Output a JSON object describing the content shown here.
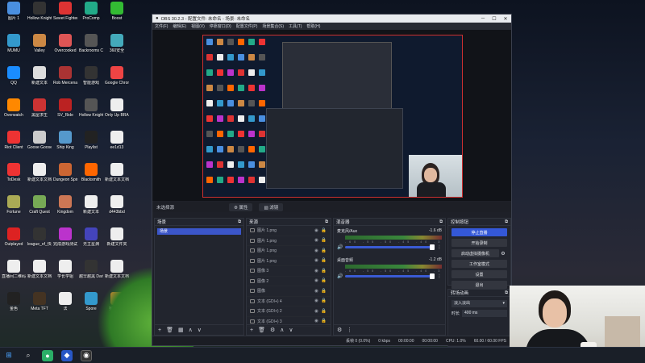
{
  "desktop_icons": [
    {
      "label": "图片 1",
      "color": "#4a8fe0",
      "col": 0,
      "row": 0
    },
    {
      "label": "Hollow Knight",
      "color": "#333",
      "col": 1,
      "row": 0
    },
    {
      "label": "Sweet Fighter",
      "color": "#d33",
      "col": 2,
      "row": 0
    },
    {
      "label": "ProComp",
      "color": "#2a8",
      "col": 3,
      "row": 0
    },
    {
      "label": "Boost",
      "color": "#3b3",
      "col": 4,
      "row": 0
    },
    {
      "label": "MUMU",
      "color": "#39c",
      "col": 0,
      "row": 1
    },
    {
      "label": "Valley",
      "color": "#c84",
      "col": 1,
      "row": 1
    },
    {
      "label": "Overcooked",
      "color": "#d55",
      "col": 2,
      "row": 1
    },
    {
      "label": "Backrooms Company",
      "color": "#555",
      "col": 3,
      "row": 1
    },
    {
      "label": "360安全",
      "color": "#4ab",
      "col": 4,
      "row": 1
    },
    {
      "label": "QQ",
      "color": "#1a8cff",
      "col": 0,
      "row": 2
    },
    {
      "label": "新建文本",
      "color": "#ddd",
      "col": 1,
      "row": 2
    },
    {
      "label": "Rob Mercenaries",
      "color": "#a33",
      "col": 2,
      "row": 2
    },
    {
      "label": "智能游戏",
      "color": "#333",
      "col": 3,
      "row": 2
    },
    {
      "label": "Google Chrome",
      "color": "#e44",
      "col": 4,
      "row": 2
    },
    {
      "label": "Overwatch",
      "color": "#f80",
      "col": 0,
      "row": 3
    },
    {
      "label": "黑屋求生",
      "color": "#c33",
      "col": 1,
      "row": 3
    },
    {
      "label": "SV_Ride",
      "color": "#b22",
      "col": 2,
      "row": 3
    },
    {
      "label": "Hollow Knight",
      "color": "#555",
      "col": 3,
      "row": 3
    },
    {
      "label": "Only Up BRAINROT",
      "color": "#eee",
      "col": 4,
      "row": 3
    },
    {
      "label": "Riot Client",
      "color": "#e33",
      "col": 0,
      "row": 4
    },
    {
      "label": "Goose Goose Duck",
      "color": "#ccc",
      "col": 1,
      "row": 4
    },
    {
      "label": "Ship King",
      "color": "#59c",
      "col": 2,
      "row": 4
    },
    {
      "label": "Playlist",
      "color": "#222",
      "col": 3,
      "row": 4
    },
    {
      "label": "ee1d13",
      "color": "#eee",
      "col": 4,
      "row": 4
    },
    {
      "label": "ToDesk",
      "color": "#e33",
      "col": 0,
      "row": 5
    },
    {
      "label": "新建文本文档",
      "color": "#eee",
      "col": 1,
      "row": 5
    },
    {
      "label": "Dungeon Spirits",
      "color": "#c63",
      "col": 2,
      "row": 5
    },
    {
      "label": "Blacksmith",
      "color": "#f60",
      "col": 3,
      "row": 5
    },
    {
      "label": "新建文本文档",
      "color": "#eee",
      "col": 4,
      "row": 5
    },
    {
      "label": "Fortune",
      "color": "#aa5",
      "col": 0,
      "row": 6
    },
    {
      "label": "Craft Quest",
      "color": "#7a5",
      "col": 1,
      "row": 6
    },
    {
      "label": "Kingdom",
      "color": "#c75",
      "col": 2,
      "row": 6
    },
    {
      "label": "新建文本",
      "color": "#eee",
      "col": 3,
      "row": 6
    },
    {
      "label": "d443bbd",
      "color": "#eee",
      "col": 4,
      "row": 6
    },
    {
      "label": "Outplayed",
      "color": "#d22",
      "col": 0,
      "row": 7
    },
    {
      "label": "league_of_快捷方式",
      "color": "#333",
      "col": 1,
      "row": 7
    },
    {
      "label": "完成游戏测试",
      "color": "#b3c",
      "col": 2,
      "row": 7
    },
    {
      "label": "无主星渊",
      "color": "#44b",
      "col": 3,
      "row": 7
    },
    {
      "label": "新建文件夹",
      "color": "#eee",
      "col": 4,
      "row": 7
    },
    {
      "label": "直播间二维码",
      "color": "#eee",
      "col": 0,
      "row": 8
    },
    {
      "label": "新建文本文档",
      "color": "#eee",
      "col": 1,
      "row": 8
    },
    {
      "label": "学长学姐",
      "color": "#eee",
      "col": 2,
      "row": 8
    },
    {
      "label": "越早越黑 Dark",
      "color": "#333",
      "col": 3,
      "row": 8
    },
    {
      "label": "新建文本文档",
      "color": "#eee",
      "col": 4,
      "row": 8
    },
    {
      "label": "金色",
      "color": "#222",
      "col": 0,
      "row": 9
    },
    {
      "label": "Meta TFT",
      "color": "#432",
      "col": 1,
      "row": 9
    },
    {
      "label": "法",
      "color": "#eee",
      "col": 2,
      "row": 9
    },
    {
      "label": "Spore",
      "color": "#39c",
      "col": 3,
      "row": 9
    },
    {
      "label": "猴子启航",
      "color": "#e83",
      "col": 4,
      "row": 9
    }
  ],
  "window": {
    "title": "OBS 30.2.3 - 配置文件: 未命名 - 场景: 未命名",
    "menu": [
      "文件(F)",
      "编辑(E)",
      "视图(V)",
      "停靠窗口(D)",
      "配置文件(P)",
      "场景集合(S)",
      "工具(T)",
      "帮助(H)"
    ]
  },
  "context_bar": {
    "label": "未选择源",
    "properties": "⚙ 属性",
    "filters": "▧ 滤镜"
  },
  "scenes": {
    "title": "场景",
    "items": [
      "场景"
    ]
  },
  "sources": {
    "title": "来源",
    "items": [
      "图片 1.png",
      "图片 1.png",
      "图片 1.png",
      "图片 1.png",
      "图像 3",
      "图像 2",
      "图像",
      "文本 (GDI+) 4",
      "文本 (GDI+) 2",
      "文本 (GDI+) 3"
    ]
  },
  "mixer": {
    "title": "混音器",
    "channels": [
      {
        "name": "麦克风/Aux",
        "db": "-1.6 dB"
      },
      {
        "name": "桌面音频",
        "db": "-1.2 dB"
      }
    ],
    "scale": "-60 -55 -50 -45 -40 -35 -30 -25 -20 -15 -10 -5 0"
  },
  "controls": {
    "title": "控制按钮",
    "stop_stream": "停止直播",
    "start_record": "开始录制",
    "virtual_cam": "启动虚拟摄像机",
    "studio_mode": "工作室模式",
    "settings": "设置",
    "exit": "退出"
  },
  "transitions": {
    "title": "转场动画",
    "selected": "淡入淡出",
    "duration_label": "时长",
    "duration_value": "400 ms"
  },
  "status": {
    "dropped": "丢帧 0 (0.0%)",
    "bitrate": "0 kbps",
    "stream_time": "00:00:00",
    "record_time": "00:00:00",
    "cpu": "CPU: 1.0%",
    "fps": "60.00 / 60.00 FPS"
  }
}
